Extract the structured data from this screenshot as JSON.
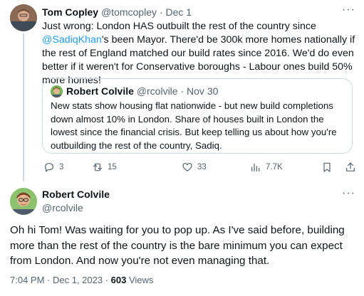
{
  "parent_tweet": {
    "name": "Tom Copley",
    "handle": "@tomcopley",
    "separator": " · ",
    "date": "Dec 1",
    "text_before": "Just wrong: London HAS outbuilt the rest of the country since ",
    "mention": "@SadiqKhan",
    "text_after": "'s been Mayor. There'd be 300k more homes nationally if the rest of England matched our build rates since 2016. We'd do even better if it weren't for Conservative boroughs - Labour ones build 50% more homes!",
    "more_label": "···",
    "quote": {
      "name": "Robert Colvile",
      "handle": "@rcolvile",
      "separator": " · ",
      "date": "Nov 30",
      "text": "New stats show housing flat nationwide - but new build completions down almost 10% in London. Share of houses built in London the lowest since the financial crisis. But keep telling us about how you're outbuilding the rest of the country, Sadiq."
    },
    "actions": {
      "replies": "3",
      "retweets": "15",
      "likes": "33",
      "views": "7.7K"
    }
  },
  "main_tweet": {
    "name": "Robert Colvile",
    "handle": "@rcolvile",
    "more_label": "···",
    "text": "Oh hi Tom! Was waiting for you to pop up. As I've said before, building more than the rest of the country is the bare minimum you can expect from London. And now you're not even managing that.",
    "timestamp": "7:04 PM · Dec 1, 2023 · ",
    "views_count": "603",
    "views_label": " Views"
  },
  "colors": {
    "accent": "#1d9bf0",
    "muted": "#536471",
    "border": "#cfd9de",
    "text": "#0f1419"
  },
  "icons": [
    "reply-icon",
    "retweet-icon",
    "like-icon",
    "views-icon",
    "bookmark-icon",
    "share-icon",
    "more-icon"
  ]
}
